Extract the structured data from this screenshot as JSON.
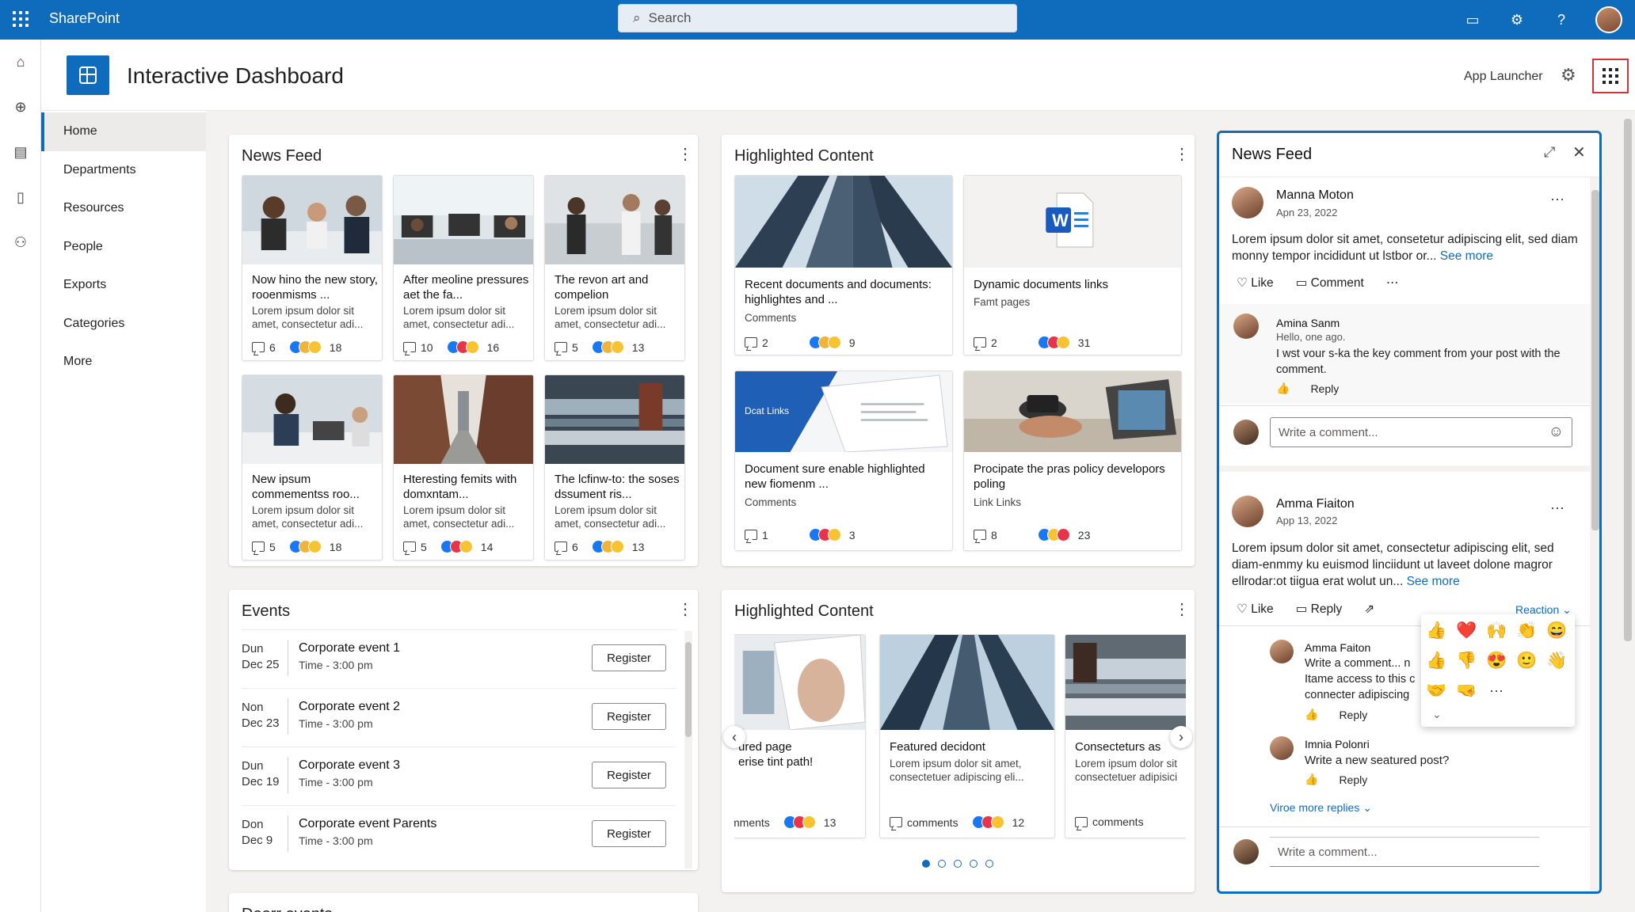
{
  "app": {
    "brand": "SharePoint",
    "search_placeholder": "Search"
  },
  "page": {
    "title": "Interactive Dashboard",
    "app_launcher_label": "App Launcher"
  },
  "nav": {
    "items": [
      "Home",
      "Departments",
      "Resources",
      "People",
      "Exports",
      "Categories",
      "More"
    ],
    "active": "Home"
  },
  "news_feed": {
    "title": "News Feed",
    "items": [
      {
        "title": "Now hino the new story, rooenmisms ...",
        "desc": "Lorem ipsum dolor sit amet, consectetur adi...",
        "comments": "6",
        "reactions": "18",
        "r": [
          "like",
          "thumb",
          "wow"
        ]
      },
      {
        "title": "After meoline pressures aet the fa...",
        "desc": "Lorem ipsum dolor sit amet, consectetur adi...",
        "comments": "10",
        "reactions": "16",
        "r": [
          "like",
          "love",
          "wow"
        ]
      },
      {
        "title": "The revon art and compelion",
        "desc": "Lorem ipsum dolor sit amet, consectetur adi...",
        "comments": "5",
        "reactions": "13",
        "r": [
          "like",
          "thumb",
          "wow"
        ]
      },
      {
        "title": "New ipsum commementss roo...",
        "desc": "Lorem ipsum dolor sit amet, consectetur adi...",
        "comments": "5",
        "reactions": "18",
        "r": [
          "like",
          "thumb",
          "wow"
        ]
      },
      {
        "title": "Hteresting femits with domxntam...",
        "desc": "Lorem ipsum dolor sit amet, consectetur adi...",
        "comments": "5",
        "reactions": "14",
        "r": [
          "like",
          "love",
          "wow"
        ]
      },
      {
        "title": "The lcfinw-to: the soses dssument ris...",
        "desc": "Lorem ipsum dolor sit amet, consectetur adi...",
        "comments": "6",
        "reactions": "13",
        "r": [
          "like",
          "thumb",
          "wow"
        ]
      }
    ]
  },
  "highlighted": {
    "title": "Highlighted Content",
    "items": [
      {
        "title": "Recent documents and documents: highlightes and ...",
        "sub": "Comments",
        "comments": "2",
        "reactions": "9"
      },
      {
        "title": "Dynamic documents links",
        "sub": "Famt pages",
        "comments": "2",
        "reactions": "31"
      },
      {
        "title": "Document sure enable highlighted new fiomenm ...",
        "sub": "Comments",
        "comments": "1",
        "reactions": "3",
        "img_text": "Dcat Links"
      },
      {
        "title": "Procipate the pras policy developors poling",
        "sub": "Link Links",
        "comments": "8",
        "reactions": "23"
      }
    ]
  },
  "events": {
    "title": "Events",
    "items": [
      {
        "day": "Dun",
        "date": "Dec 25",
        "name": "Corporate event 1",
        "time": "Time - 3:00 pm",
        "button": "Register"
      },
      {
        "day": "Non",
        "date": "Dec 23",
        "name": "Corporate event 2",
        "time": "Time - 3:00 pm",
        "button": "Register"
      },
      {
        "day": "Dun",
        "date": "Dec 19",
        "name": "Corporate event 3",
        "time": "Time - 3:00 pm",
        "button": "Register"
      },
      {
        "day": "Don",
        "date": "Dec 9",
        "name": "Corporate event Parents",
        "time": "Time - 3:00 pm",
        "button": "Register"
      }
    ],
    "next_title": "Doorr events"
  },
  "highlighted2": {
    "title": "Highlighted Content",
    "items": [
      {
        "title": "ured page",
        "title2": "erise tint path!",
        "comments": "mments",
        "reactions": "13"
      },
      {
        "title": "Featured decidont",
        "desc": "Lorem ipsum dolor sit amet, consectetuer adipiscing eli...",
        "comments": "comments",
        "reactions": "12"
      },
      {
        "title": "Consecteturs as",
        "desc": "Lorem ipsum dolor sit consectetuer adipisici",
        "comments": "comments"
      }
    ]
  },
  "feed_panel": {
    "title": "News Feed",
    "post1": {
      "author": "Manna Moton",
      "date": "Apn 23, 2022",
      "text": "Lorem ipsum dolor sit amet, consetetur adipiscing elit, sed diam monny tempor incididunt ut lstbor or...",
      "see_more": "See more",
      "like": "Like",
      "comment": "Comment",
      "reply": {
        "author": "Amina Sanm",
        "text1": "Hello, one ago.",
        "text2": "I wst vour s-ka the key comment from your post with the comment.",
        "reply_label": "Reply"
      },
      "write": "Write a comment..."
    },
    "post2": {
      "author": "Amma Fiaiton",
      "date": "App 13, 2022",
      "text": "Lorem ipsum dolor sit amet, consectetur adipiscing elit, sed diam-enmmy ku euismod linciidunt ut laveet dolone magror ellrodar:ot tiigua erat wolut un...",
      "see_more": "See more",
      "like": "Like",
      "reply": "Reply",
      "reaction": "Reaction",
      "c1": {
        "author": "Amma Faiton",
        "text": "Write a comment... n Itame access to this c connecter adipiscing",
        "reply_label": "Reply"
      },
      "c2": {
        "author": "Imnia Polonri",
        "text": "Write a new seatured post?",
        "reply_label": "Reply"
      },
      "view_more": "Viroe more replies",
      "write": "Write a comment..."
    },
    "emojis": [
      "👍",
      "❤️",
      "🙌",
      "👏",
      "😄",
      "👍",
      "👎",
      "😍",
      "🙂",
      "👋",
      "🤝",
      "🤜",
      "⋯"
    ]
  }
}
